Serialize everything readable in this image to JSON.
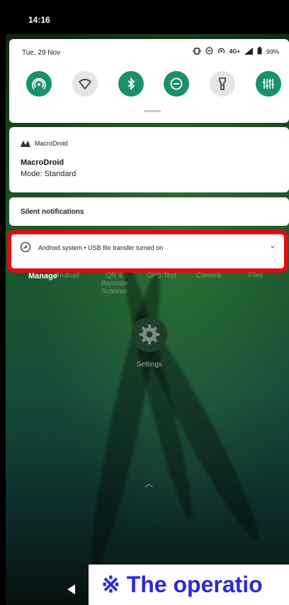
{
  "status_bar": {
    "time": "14:16"
  },
  "quick_settings": {
    "date": "Tue, 29 Nov",
    "network_label": "4G+",
    "battery_percent": "99%",
    "tiles": [
      {
        "icon": "hotspot-icon",
        "state": "on"
      },
      {
        "icon": "wifi-icon",
        "state": "off"
      },
      {
        "icon": "bluetooth-icon",
        "state": "on"
      },
      {
        "icon": "do-not-disturb-icon",
        "state": "on"
      },
      {
        "icon": "flashlight-icon",
        "state": "off"
      },
      {
        "icon": "equalizer-icon",
        "state": "on"
      }
    ]
  },
  "notification": {
    "app_name": "MacroDroid",
    "title": "MacroDroid",
    "text": "Mode: Standard"
  },
  "silent": {
    "label": "Silent notifications"
  },
  "usb_notification": {
    "text": "Android system • USB file transfer turned on"
  },
  "manage_label": "Manage",
  "home_apps": [
    "Android",
    "QR & Barcode Scanner",
    "GPS Test",
    "Camera",
    "Files"
  ],
  "settings_label": "Settings",
  "banner_text": "※ The operatio"
}
